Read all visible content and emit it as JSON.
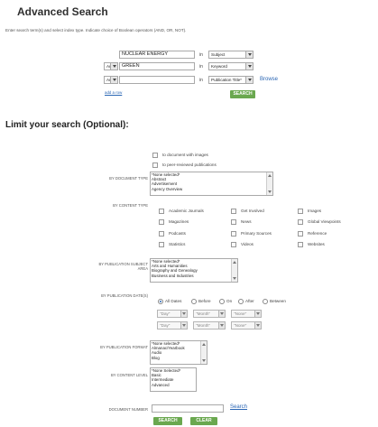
{
  "header": {
    "title": "Advanced Search",
    "intro": "Enter search term(s) and select index type. Indicate choice of Boolean operators (AND, OR, NOT)."
  },
  "search_rows": [
    {
      "operator": "",
      "term": "NUCLEAR ENERGY",
      "in_label": "in",
      "index": "Subject"
    },
    {
      "operator": "And",
      "term": "GREEN",
      "in_label": "in",
      "index": "Keyword"
    },
    {
      "operator": "And",
      "term": "",
      "in_label": "in",
      "index": "Publication Title*"
    }
  ],
  "browse_label": "Browse",
  "add_row_label": "add a row",
  "search_button": "SEARCH",
  "limit": {
    "title": "Limit your search (Optional):",
    "checks": [
      {
        "label": "to document with images",
        "checked": false
      },
      {
        "label": "to peer-reviewed publications",
        "checked": false
      }
    ],
    "document_type": {
      "label": "BY DOCUMENT TYPE",
      "options": [
        "*None selected*",
        "Abstract",
        "Advertisement",
        "Agency Overview"
      ]
    },
    "content_type": {
      "label": "BY CONTENT TYPE",
      "columns": [
        [
          "Academic Journals",
          "Magazines",
          "Podcasts",
          "Statistics"
        ],
        [
          "Get Involved",
          "News",
          "Primary Sources",
          "Videos"
        ],
        [
          "Images",
          "Global Viewpoints",
          "Reference",
          "Websites"
        ]
      ]
    },
    "subject_area": {
      "label_line1": "BY PUBLICATION SUBJECT",
      "label_line2": "AREA",
      "options": [
        "*None selected*",
        "Arts and Humanities",
        "Biography and Genealogy",
        "Business and Industries"
      ]
    },
    "pub_dates": {
      "label": "BY PUBLICATION DATE(S)",
      "radios": [
        {
          "label": "All Dates",
          "selected": true
        },
        {
          "label": "Before",
          "selected": false
        },
        {
          "label": "On",
          "selected": false
        },
        {
          "label": "After",
          "selected": false
        },
        {
          "label": "Between",
          "selected": false
        }
      ],
      "row1": [
        "\"Day\"",
        "\"Month\"",
        "\"None\""
      ],
      "row2": [
        "\"Day\"",
        "\"Month\"",
        "\"None\""
      ]
    },
    "pub_format": {
      "label": "BY PUBLICATION FORMAT",
      "options": [
        "*None selected*",
        "Almanac/Yearbook",
        "Audio",
        "Blog"
      ]
    },
    "content_level": {
      "label": "BY CONTENT LEVEL",
      "options": [
        "*None Selected*",
        "Basic",
        "Intermediate",
        "Advanced"
      ]
    },
    "document_number": {
      "label": "DOCUMENT NUMBER",
      "value": "",
      "search_link": "Search"
    }
  },
  "bottom_buttons": {
    "search": "SEARCH",
    "clear": "CLEAR"
  }
}
